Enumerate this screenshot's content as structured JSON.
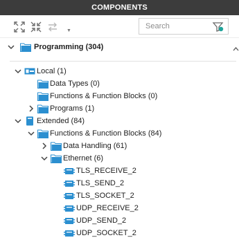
{
  "panel": {
    "title": "COMPONENTS"
  },
  "toolbar": {
    "expand_icon": "expand-all-icon",
    "collapse_icon": "collapse-all-icon",
    "link_icon": "link-icon",
    "search_placeholder": "Search",
    "filter_icon": "filter-icon"
  },
  "colors": {
    "titlebar": "#3c3c3c",
    "folder": "#2b8fd0",
    "accent": "#1a9ad6",
    "filter_badge": "#1fa39a"
  },
  "tree": {
    "root": {
      "label": "Programming (304)",
      "expanded": true
    },
    "local": {
      "label": "Local (1)",
      "expanded": true,
      "data_types": "Data Types (0)",
      "functions": "Functions & Function Blocks (0)",
      "programs": "Programs (1)"
    },
    "extended": {
      "label": "Extended (84)",
      "expanded": true,
      "functions": "Functions & Function Blocks (84)",
      "data_handling": "Data Handling (61)",
      "ethernet": {
        "label": "Ethernet (6)",
        "items": [
          "TLS_RECEIVE_2",
          "TLS_SEND_2",
          "TLS_SOCKET_2",
          "UDP_RECEIVE_2",
          "UDP_SEND_2",
          "UDP_SOCKET_2"
        ]
      }
    }
  }
}
